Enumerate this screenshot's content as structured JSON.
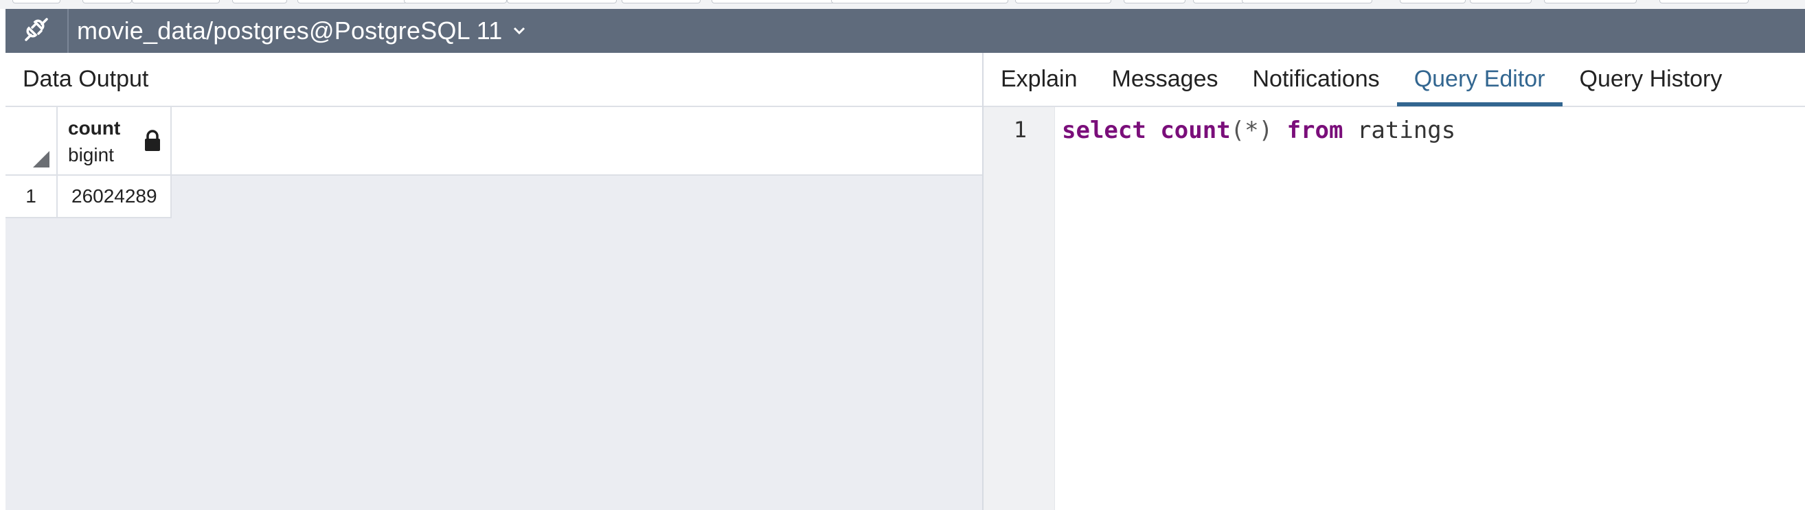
{
  "connection": {
    "title": "movie_data/postgres@PostgreSQL 11"
  },
  "left_panel": {
    "tab_label": "Data Output",
    "columns": [
      {
        "name": "count",
        "type": "bigint"
      }
    ],
    "rows": [
      {
        "row_number": "1",
        "values": [
          "26024289"
        ]
      }
    ]
  },
  "right_panel": {
    "tabs": [
      {
        "label": "Explain",
        "active": false
      },
      {
        "label": "Messages",
        "active": false
      },
      {
        "label": "Notifications",
        "active": false
      },
      {
        "label": "Query Editor",
        "active": true
      },
      {
        "label": "Query History",
        "active": false
      }
    ],
    "editor": {
      "line_number": "1",
      "tokens": {
        "kw_select": "select",
        "kw_count": "count",
        "punc_args": "(*)",
        "kw_from": "from",
        "ident_table": "ratings"
      }
    }
  },
  "colors": {
    "connection_bar": "#5f6b7c",
    "active_tab": "#326690",
    "sql_keyword": "#7a0e7a",
    "grid_background": "#ebedf2"
  },
  "icons": {
    "connection": "plug-disconnected-icon",
    "dropdown": "chevron-down-icon",
    "lock": "lock-icon",
    "sort_corner": "corner-triangle-icon"
  }
}
